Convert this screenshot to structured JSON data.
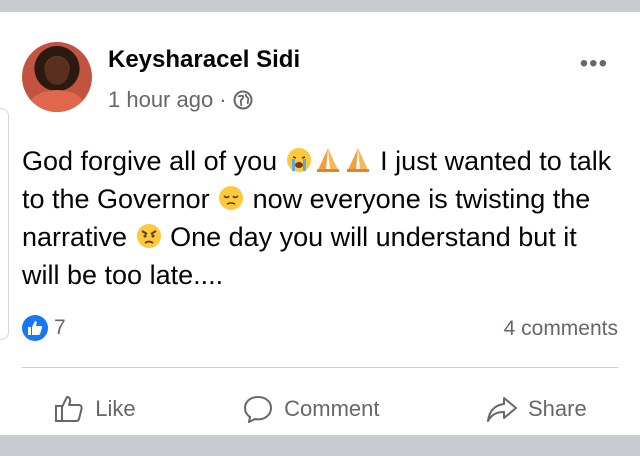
{
  "post": {
    "author": "Keysharacel Sidi",
    "time": "1 hour ago",
    "separator": "·",
    "more_label": "•••",
    "text_parts": [
      "God forgive all of you ",
      " I just wanted to talk to the Governor ",
      " now everyone is twisting the narrative ",
      " One day you will understand but it will be too late...."
    ],
    "emojis": [
      "crying-face",
      "folded-hands",
      "folded-hands",
      "pensive-face",
      "angry-face"
    ]
  },
  "reactions": {
    "count": "7",
    "comments": "4 comments"
  },
  "actions": {
    "like": "Like",
    "comment": "Comment",
    "share": "Share"
  },
  "colors": {
    "brand": "#1877f2",
    "secondary_text": "#65676b",
    "divider": "#ced0d4",
    "emoji_yellow": "#ffc83d",
    "background": "#c9ccd1"
  }
}
